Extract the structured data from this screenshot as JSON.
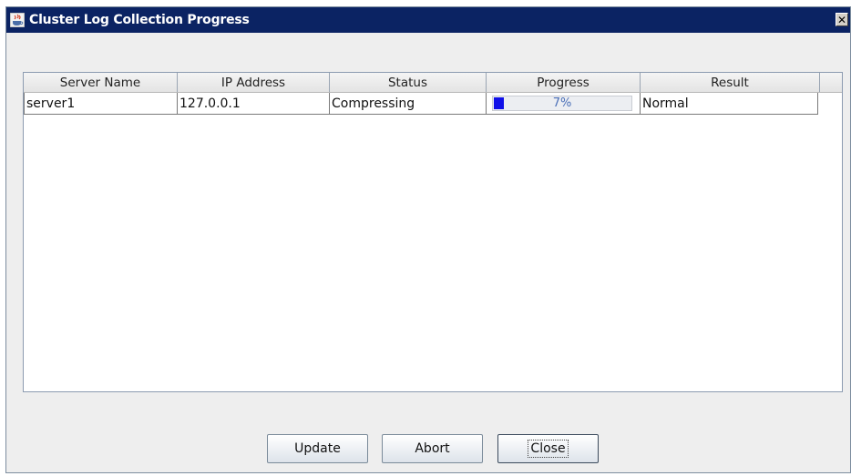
{
  "window": {
    "title": "Cluster Log Collection Progress",
    "close_glyph": "✕",
    "app_icon": "java-cup-icon"
  },
  "table": {
    "columns": [
      "Server Name",
      "IP Address",
      "Status",
      "Progress",
      "Result"
    ],
    "rows": [
      {
        "server_name": "server1",
        "ip_address": "127.0.0.1",
        "status": "Compressing",
        "progress_label": "7%",
        "progress_value": 0.07,
        "result": "Normal"
      }
    ]
  },
  "buttons": {
    "update": "Update",
    "abort": "Abort",
    "close": "Close"
  },
  "colors": {
    "titlebar": "#0b2363",
    "progress_fill": "#1010e8",
    "progress_text": "#4a6fb8"
  }
}
